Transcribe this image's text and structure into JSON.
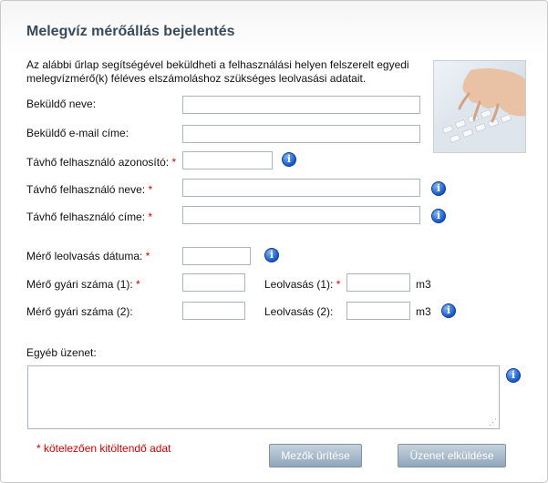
{
  "form": {
    "title": "Melegvíz mérőállás bejelentés",
    "intro_line1": "Az alábbi űrlap segítségével beküldheti a felhasználási helyen felszerelt egyedi",
    "intro_line2": "melegvízmérő(k) féléves elszámoláshoz szükséges leolvasási adatait."
  },
  "fields": {
    "sender_name": {
      "label": "Beküldő neve:",
      "value": ""
    },
    "sender_email": {
      "label": "Beküldő e-mail címe:",
      "value": ""
    },
    "consumer_id": {
      "label": "Távhő felhasználó azonosító:",
      "required": "*",
      "value": ""
    },
    "consumer_name": {
      "label": "Távhő felhasználó neve:",
      "required": "*",
      "value": ""
    },
    "consumer_address": {
      "label": "Távhő felhasználó címe:",
      "required": "*",
      "value": ""
    },
    "reading_date": {
      "label": "Mérő leolvasás dátuma:",
      "required": "*",
      "value": ""
    },
    "meter_serial_1": {
      "label": "Mérő gyári száma (1):",
      "required": "*",
      "value": ""
    },
    "meter_serial_2": {
      "label": "Mérő gyári száma (2):",
      "value": ""
    },
    "reading_1": {
      "label": "Leolvasás (1):",
      "required": "*",
      "value": "",
      "unit": "m3"
    },
    "reading_2": {
      "label": "Leolvasás (2):",
      "value": "",
      "unit": "m3"
    },
    "message": {
      "label": "Egyéb üzenet:",
      "value": ""
    }
  },
  "info_icon_glyph": "i",
  "required_note": "* kötelezően kitöltendő adat",
  "buttons": {
    "clear": "Mezők ürítése",
    "send": "Üzenet elküldése"
  },
  "colors": {
    "title": "#384a5c",
    "required": "#d40000",
    "info_icon": "#1458c8",
    "button": "#a9bccd"
  }
}
